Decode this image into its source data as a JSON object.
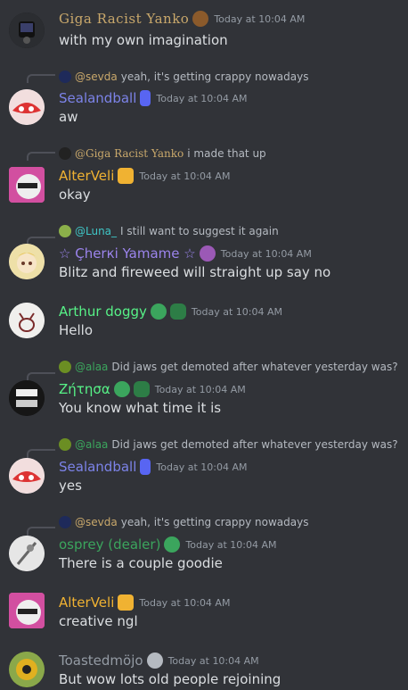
{
  "messages": [
    {
      "author": "Giga Racist Yanko",
      "time": "Today at 10:04 AM",
      "text": "with my own imagination"
    },
    {
      "reply": {
        "name": "@sevda",
        "text": "yeah, it's getting crappy nowadays"
      },
      "author": "Sealandball",
      "time": "Today at 10:04 AM",
      "text": "aw"
    },
    {
      "reply": {
        "name": "@Giga Racist Yanko",
        "text": "i made that up"
      },
      "author": "AlterVeli",
      "time": "Today at 10:04 AM",
      "text": "okay"
    },
    {
      "reply": {
        "name": "@Luna_",
        "text": "I still want to suggest it again"
      },
      "author": "☆ Çherкi Yamame ☆",
      "time": "Today at 10:04 AM",
      "text": "Blitz and fireweed will straight up say no"
    },
    {
      "author": "Arthur doggy",
      "time": "Today at 10:04 AM",
      "text": "Hello"
    },
    {
      "reply": {
        "name": "@alaa",
        "text": "Did jaws get demoted after whatever yesterday was?"
      },
      "author": "Ζήτησα",
      "time": "Today at 10:04 AM",
      "text": "You know what time it is"
    },
    {
      "reply": {
        "name": "@alaa",
        "text": "Did jaws get demoted after whatever yesterday was?"
      },
      "author": "Sealandball",
      "time": "Today at 10:04 AM",
      "text": "yes"
    },
    {
      "reply": {
        "name": "@sevda",
        "text": "yeah, it's getting crappy nowadays"
      },
      "author": "osprey (dealer)",
      "time": "Today at 10:04 AM",
      "text": "There is a couple goodie"
    },
    {
      "author": "AlterVeli",
      "time": "Today at 10:04 AM",
      "text": "creative ngl"
    },
    {
      "author": "Toastedmöjo",
      "time": "Today at 10:04 AM",
      "text": "But wow lots old people rejoining"
    }
  ],
  "colors": {
    "background": "#313338",
    "yanko": "#c9a86b",
    "sealandball": "#7c83e8",
    "alterveli": "#f0b232",
    "cherki": "#9b84ec",
    "arthur": "#57f287",
    "zitisa": "#57f287",
    "osprey": "#3ba55d",
    "toasted": "#949ba4",
    "luna": "#3fc7c7",
    "alaa": "#3ba55d"
  }
}
